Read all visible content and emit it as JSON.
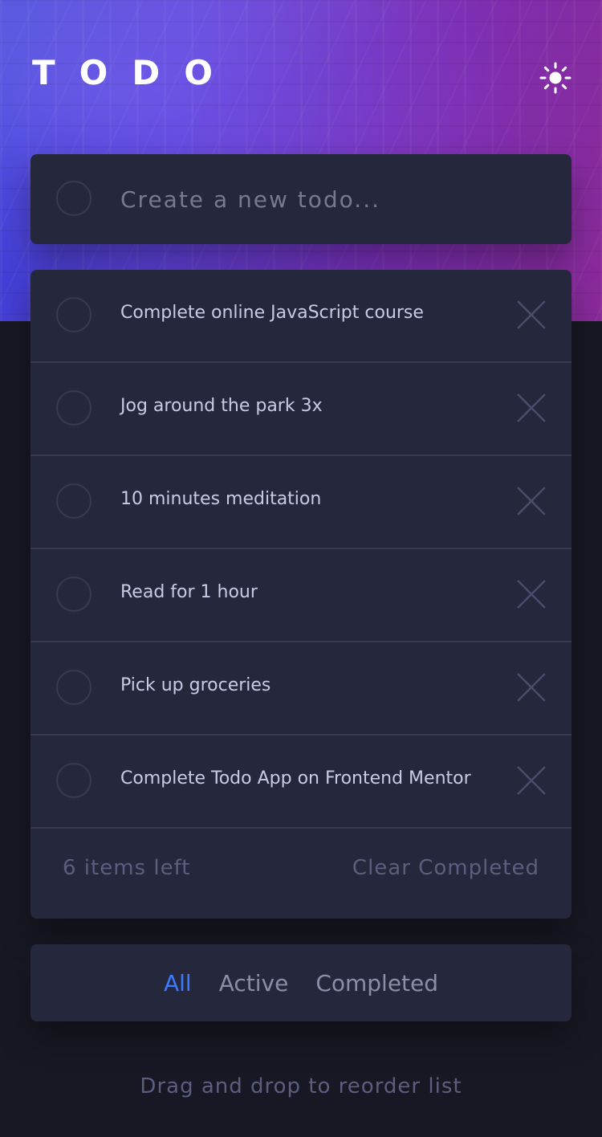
{
  "header": {
    "title": "TODO",
    "theme_icon": "sun-icon"
  },
  "new_todo": {
    "placeholder": "Create a new todo..."
  },
  "todos": [
    {
      "text": "Complete online JavaScript course",
      "completed": false
    },
    {
      "text": "Jog around the park 3x",
      "completed": false
    },
    {
      "text": "10 minutes meditation",
      "completed": false
    },
    {
      "text": "Read for 1 hour",
      "completed": false
    },
    {
      "text": "Pick up groceries",
      "completed": false
    },
    {
      "text": "Complete Todo App on Frontend Mentor",
      "completed": false
    }
  ],
  "footer": {
    "items_left": "6 items left",
    "clear_completed": "Clear Completed"
  },
  "filters": {
    "all": "All",
    "active": "Active",
    "completed": "Completed",
    "selected": "All"
  },
  "hint": "Drag and drop to reorder list",
  "colors": {
    "accent": "#3a7cfd",
    "card_bg": "#25273d",
    "page_bg": "#171823",
    "text": "#c8cbe7",
    "muted": "#5b5e7e"
  }
}
